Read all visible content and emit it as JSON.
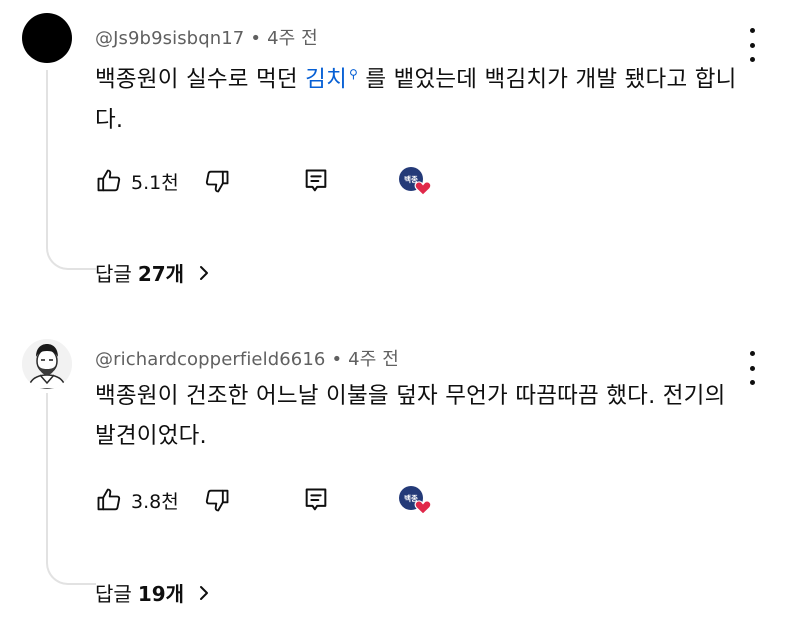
{
  "comments": [
    {
      "handle": "@Js9b9sisbqn17",
      "time": "4주 전",
      "text_before": "백종원이 실수로 먹던 ",
      "link_text": "김치",
      "text_after": " 를 뱉었는데 백김치가 개발 됐다고 합니다.",
      "likes": "5.1천",
      "replies_label": "답글",
      "replies_count": "27개"
    },
    {
      "handle": "@richardcopperfield6616",
      "time": "4주 전",
      "text": "백종원이 건조한 어느날 이불을 덮자 무언가 따끔따끔 했다. 전기의 발견이었다.",
      "likes": "3.8천",
      "replies_label": "답글",
      "replies_count": "19개"
    }
  ],
  "badge_text": "백종",
  "icons": [
    "like-icon",
    "dislike-icon",
    "reply-icon",
    "creator-heart-icon",
    "more-vert-icon",
    "chevron-right-icon"
  ]
}
